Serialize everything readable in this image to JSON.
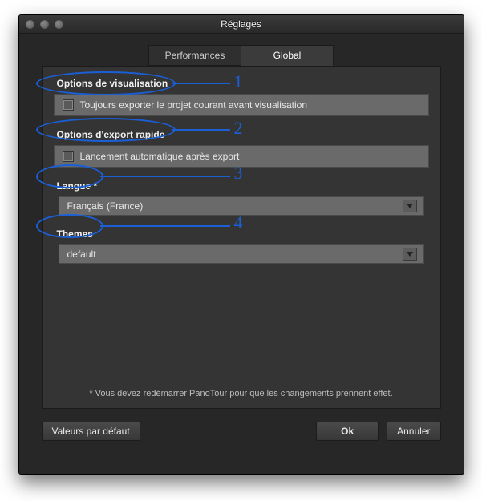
{
  "window": {
    "title": "Réglages"
  },
  "tabs": {
    "performances": "Performances",
    "global": "Global"
  },
  "sections": {
    "view_options": {
      "heading": "Options de visualisation",
      "checkbox_label": "Toujours exporter le projet courant avant visualisation"
    },
    "quick_export": {
      "heading": "Options d'export rapide",
      "checkbox_label": "Lancement automatique après export"
    },
    "language": {
      "heading": "Langue *",
      "selected": "Français (France)"
    },
    "themes": {
      "heading": "Themes",
      "selected": "default"
    }
  },
  "footnote": "* Vous devez redémarrer PanoTour pour que les changements prennent effet.",
  "buttons": {
    "defaults": "Valeurs par défaut",
    "ok": "Ok",
    "cancel": "Annuler"
  },
  "annotations": {
    "n1": "1",
    "n2": "2",
    "n3": "3",
    "n4": "4"
  }
}
